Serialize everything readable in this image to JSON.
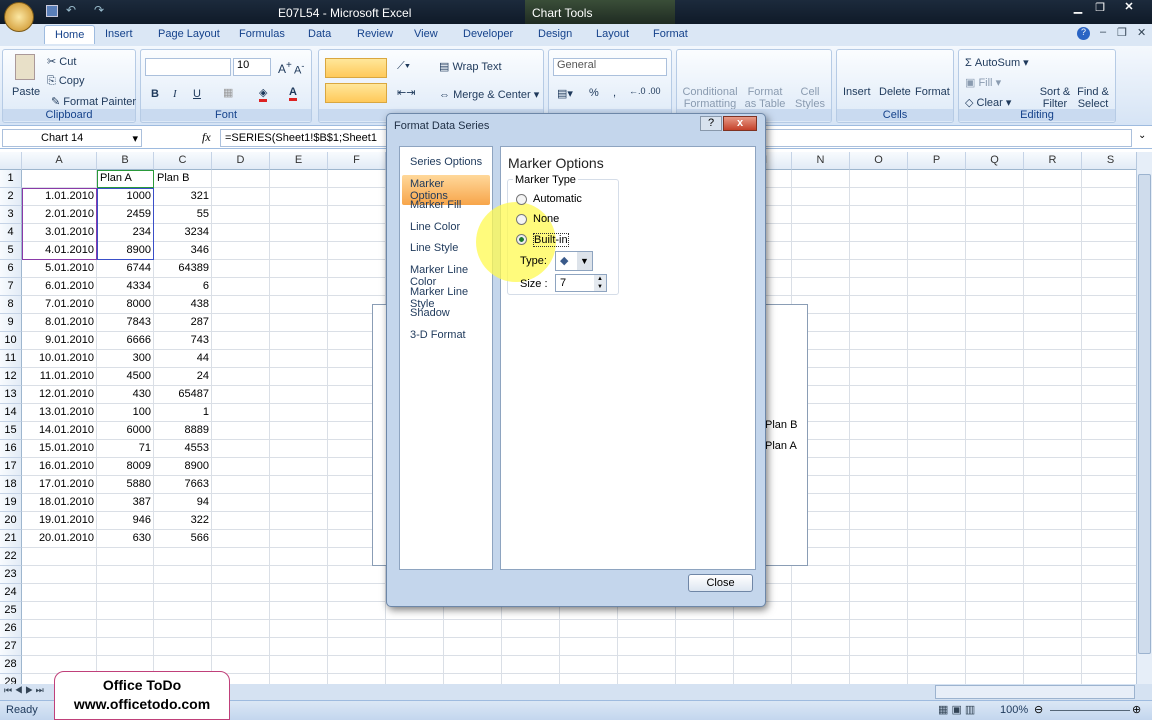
{
  "window": {
    "title": "E07L54 - Microsoft Excel",
    "context_tab": "Chart Tools"
  },
  "tabs": [
    "Home",
    "Insert",
    "Page Layout",
    "Formulas",
    "Data",
    "Review",
    "View",
    "Developer",
    "Design",
    "Layout",
    "Format"
  ],
  "ribbon": {
    "clipboard": {
      "label": "Clipboard",
      "paste": "Paste",
      "cut": "Cut",
      "copy": "Copy",
      "format_painter": "Format Painter"
    },
    "font": {
      "label": "Font",
      "font_name": "",
      "font_size": "10",
      "bold": "B",
      "italic": "I",
      "underline": "U"
    },
    "alignment": {
      "wrap_text": "Wrap Text",
      "merge_center": "Merge & Center"
    },
    "number": {
      "format": "General",
      "percent": "%",
      "comma": ","
    },
    "styles": {
      "conditional": "Conditional Formatting",
      "format_table": "Format as Table",
      "cell_styles": "Cell Styles"
    },
    "cells": {
      "label": "Cells",
      "insert": "Insert",
      "delete": "Delete",
      "format": "Format"
    },
    "editing": {
      "label": "Editing",
      "autosum": "AutoSum",
      "fill": "Fill",
      "clear": "Clear",
      "sort_filter": "Sort & Filter",
      "find_select": "Find & Select"
    }
  },
  "formula_bar": {
    "name_box": "Chart 14",
    "fx": "fx",
    "formula": "=SERIES(Sheet1!$B$1;Sheet1"
  },
  "columns": [
    "A",
    "B",
    "C",
    "D",
    "E",
    "F",
    "G",
    "H",
    "I",
    "J",
    "K",
    "L",
    "M",
    "N",
    "O",
    "P",
    "Q",
    "R",
    "S"
  ],
  "rows": [
    [
      "",
      "Plan A",
      "Plan B"
    ],
    [
      "1.01.2010",
      "1000",
      "321"
    ],
    [
      "2.01.2010",
      "2459",
      "55"
    ],
    [
      "3.01.2010",
      "234",
      "3234"
    ],
    [
      "4.01.2010",
      "8900",
      "346"
    ],
    [
      "5.01.2010",
      "6744",
      "64389"
    ],
    [
      "6.01.2010",
      "4334",
      "6"
    ],
    [
      "7.01.2010",
      "8000",
      "438"
    ],
    [
      "8.01.2010",
      "7843",
      "287"
    ],
    [
      "9.01.2010",
      "6666",
      "743"
    ],
    [
      "10.01.2010",
      "300",
      "44"
    ],
    [
      "11.01.2010",
      "4500",
      "24"
    ],
    [
      "12.01.2010",
      "430",
      "65487"
    ],
    [
      "13.01.2010",
      "100",
      "1"
    ],
    [
      "14.01.2010",
      "6000",
      "8889"
    ],
    [
      "15.01.2010",
      "71",
      "4553"
    ],
    [
      "16.01.2010",
      "8009",
      "8900"
    ],
    [
      "17.01.2010",
      "5880",
      "7663"
    ],
    [
      "18.01.2010",
      "387",
      "94"
    ],
    [
      "19.01.2010",
      "946",
      "322"
    ],
    [
      "20.01.2010",
      "630",
      "566"
    ]
  ],
  "row_count": 29,
  "chart": {
    "legend": [
      "Plan B",
      "Plan A"
    ]
  },
  "dialog": {
    "title": "Format Data Series",
    "help": "?",
    "close_x": "x",
    "nav": [
      "Series Options",
      "Marker Options",
      "Marker Fill",
      "Line Color",
      "Line Style",
      "Marker Line Color",
      "Marker Line Style",
      "Shadow",
      "3-D Format"
    ],
    "selected_nav": "Marker Options",
    "heading": "Marker Options",
    "group": "Marker Type",
    "options": [
      "Automatic",
      "None",
      "Built-in"
    ],
    "selected_option": "Built-in",
    "type_label": "Type:",
    "type_value": "◆",
    "size_label": "Size :",
    "size_value": "7",
    "close_button": "Close"
  },
  "watermark": {
    "line1": "Office ToDo",
    "line2": "www.officetodo.com"
  },
  "status": {
    "text": "Ready",
    "zoom": "100%"
  }
}
